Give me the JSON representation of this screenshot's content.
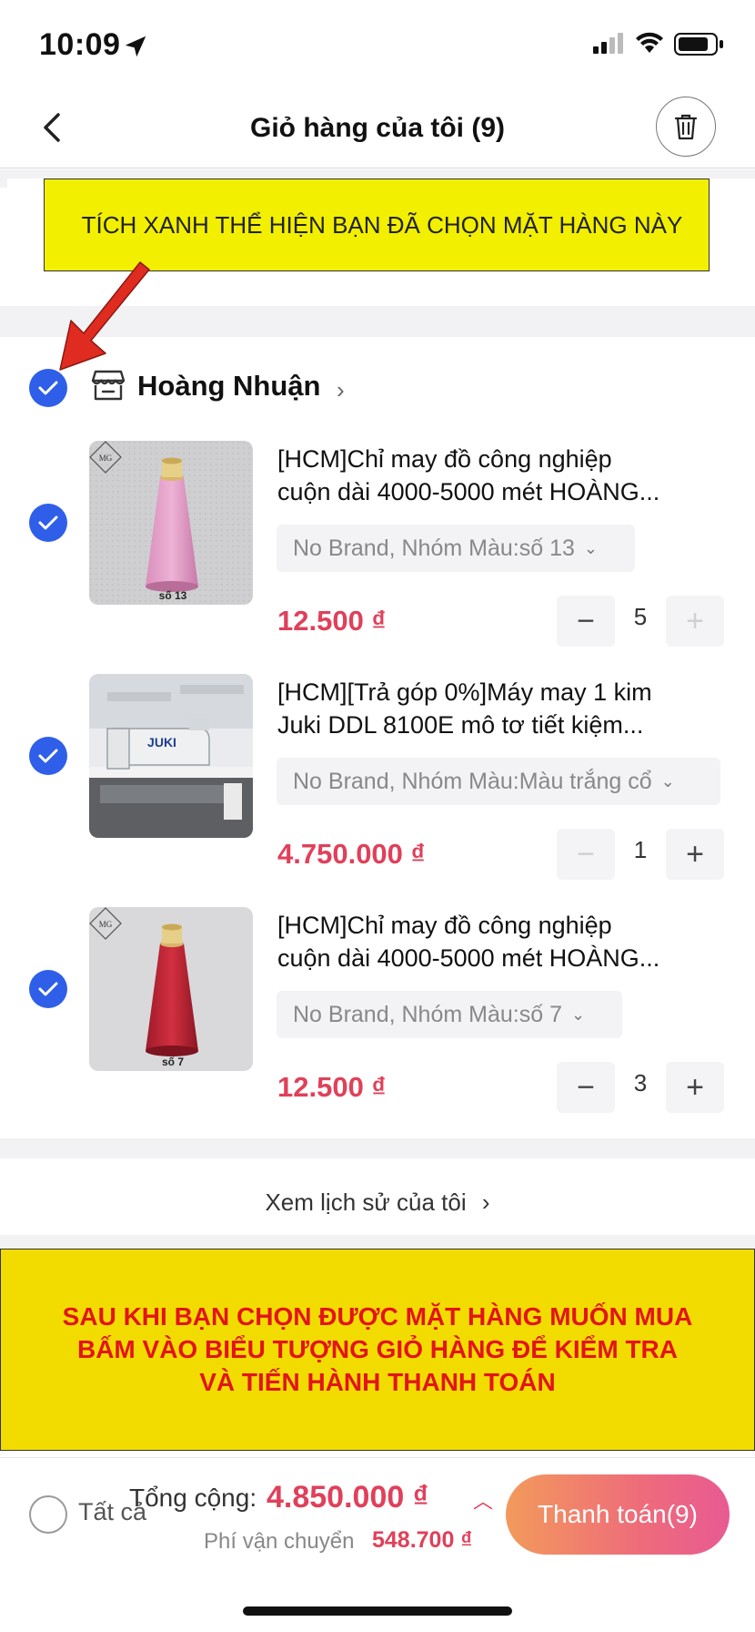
{
  "status_bar": {
    "time": "10:09"
  },
  "header": {
    "title": "Giỏ hàng của tôi (9)"
  },
  "annotation_top": {
    "text": "TÍCH XANH THỂ HIỆN BẠN ĐÃ CHỌN MẶT HÀNG NÀY"
  },
  "shop": {
    "name": "Hoàng Nhuận",
    "chevron": "›"
  },
  "items": [
    {
      "name_line1": "[HCM]Chỉ may đồ công nghiệp",
      "name_line2": "cuộn dài 4000-5000 mét HOÀNG...",
      "variant": "No Brand, Nhóm Màu:số 13",
      "price": "12.500 ₫",
      "qty": "5",
      "thumb_caption": "số 13",
      "thumb_logo": "MG",
      "thread_color": "#eeb2d6"
    },
    {
      "name_line1": "[HCM][Trả góp 0%]Máy may 1 kim",
      "name_line2": "Juki DDL 8100E mô tơ tiết kiệm...",
      "variant": "No Brand, Nhóm Màu:Màu trắng cổ",
      "price": "4.750.000 ₫",
      "qty": "1",
      "machine_brand": "JUKI"
    },
    {
      "name_line1": "[HCM]Chỉ may đồ công nghiệp",
      "name_line2": "cuộn dài 4000-5000 mét HOÀNG...",
      "variant": "No Brand, Nhóm Màu:số 7",
      "price": "12.500 ₫",
      "qty": "3",
      "thumb_caption": "số 7",
      "thumb_logo": "MG",
      "thread_color": "#c8283a"
    }
  ],
  "history_link": {
    "label": "Xem lịch sử của tôi",
    "chevron": "›"
  },
  "annotation_bottom": {
    "line1": "SAU KHI BẠN CHỌN ĐƯỢC MẶT HÀNG MUỐN MUA",
    "line2": "BẤM VÀO BIỂU TƯỢNG GIỎ HÀNG ĐỂ KIỂM TRA",
    "line3": "VÀ TIẾN HÀNH THANH TOÁN"
  },
  "bottom_bar": {
    "select_all_label": "Tất cả",
    "total_label": "Tổng cộng:",
    "total_value": "4.850.000 ₫",
    "shipping_label": "Phí vận chuyển",
    "shipping_value": "548.700 ₫",
    "checkout_label": "Thanh toán(9)"
  },
  "colors": {
    "accent_blue": "#2f5fe8",
    "price_red": "#e0405a",
    "annotation_yellow": "#f2ef00",
    "annotation_red_text": "#e3141a"
  }
}
